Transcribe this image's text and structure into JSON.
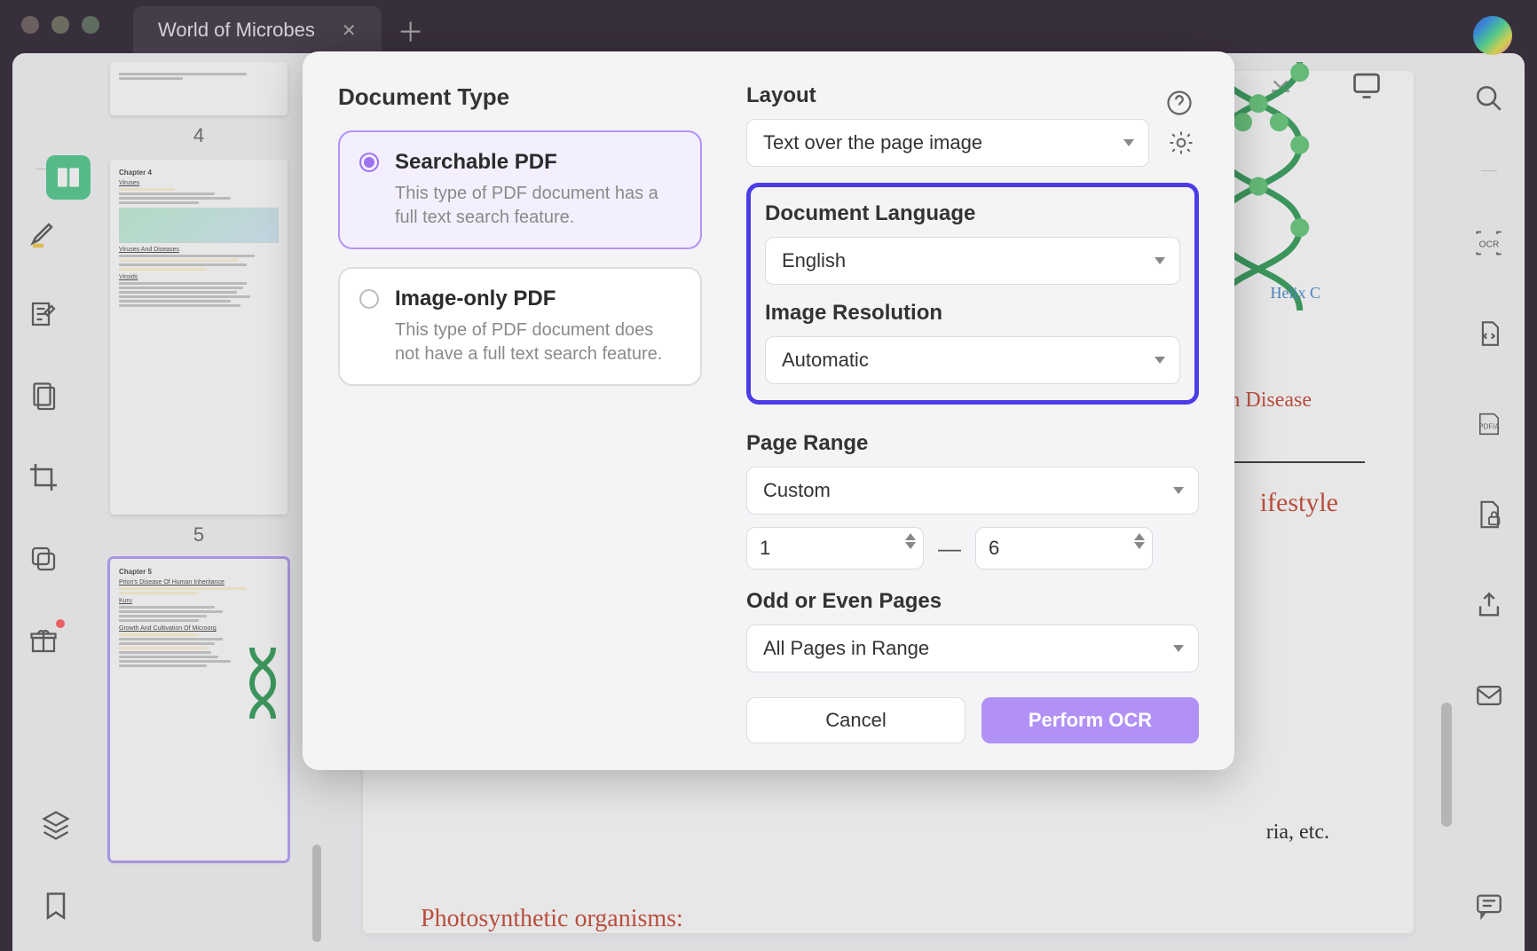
{
  "tab": {
    "title": "World of Microbes"
  },
  "thumbs": {
    "pages": [
      "4",
      "5"
    ]
  },
  "modal": {
    "doc_type_title": "Document Type",
    "option1": {
      "title": "Searchable PDF",
      "desc": "This type of PDF document has a full text search feature."
    },
    "option2": {
      "title": "Image-only PDF",
      "desc": "This type of PDF document does not have a full text search feature."
    },
    "layout_label": "Layout",
    "layout_value": "Text over the page image",
    "lang_label": "Document Language",
    "lang_value": "English",
    "res_label": "Image Resolution",
    "res_value": "Automatic",
    "range_label": "Page Range",
    "range_value": "Custom",
    "range_from": "1",
    "range_to": "6",
    "odd_even_label": "Odd or Even Pages",
    "odd_even_value": "All Pages in Range",
    "cancel": "Cancel",
    "perform": "Perform OCR"
  },
  "doc": {
    "helix_label": "Helix C",
    "disease": "n Disease",
    "lifestyle": "ifestyle",
    "ria": "ria, etc.",
    "photo": "Photosynthetic organisms:"
  },
  "right_tools": {
    "ocr": "OCR",
    "pdfa": "PDF/A"
  }
}
